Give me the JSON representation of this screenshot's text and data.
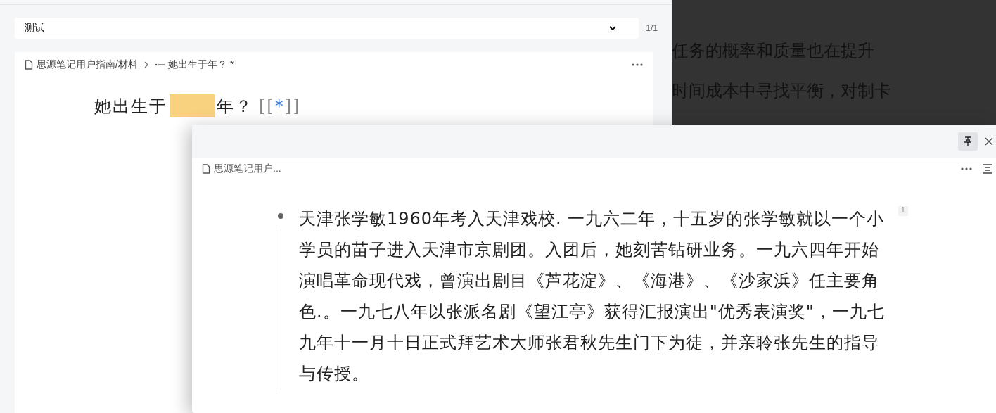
{
  "deck_select": {
    "value": "测试",
    "count": "1/1"
  },
  "card": {
    "breadcrumb": [
      {
        "kind": "doc",
        "label": "思源笔记用户指南/材料"
      },
      {
        "kind": "block",
        "label": "她出生于年？ *"
      }
    ],
    "question": {
      "before": "她出生于",
      "after": "年？",
      "ref_open": "[[",
      "ref_mark": "*",
      "ref_close": "]]"
    }
  },
  "background_lines": [
    "任务的概率和质量也在提升",
    "时间成本中寻找平衡，对制卡"
  ],
  "popup": {
    "pinned": true,
    "breadcrumb": "思源笔记用户...",
    "paragraph": "天津张学敏1960年考入天津戏校. 一九六二年，十五岁的张学敏就以一个小学员的苗子进入天津市京剧团。入团后，她刻苦钻研业务。一九六四年开始演唱革命现代戏，曾演出剧目《芦花淀》、《海港》、《沙家浜》任主要角色.。一九七八年以张派名剧《望江亭》获得汇报演出\"优秀表演奖\"，一九七九年十一月十日正式拜艺术大师张君秋先生门下为徒，并亲聆张先生的指导与传授。",
    "footnote": "1"
  }
}
